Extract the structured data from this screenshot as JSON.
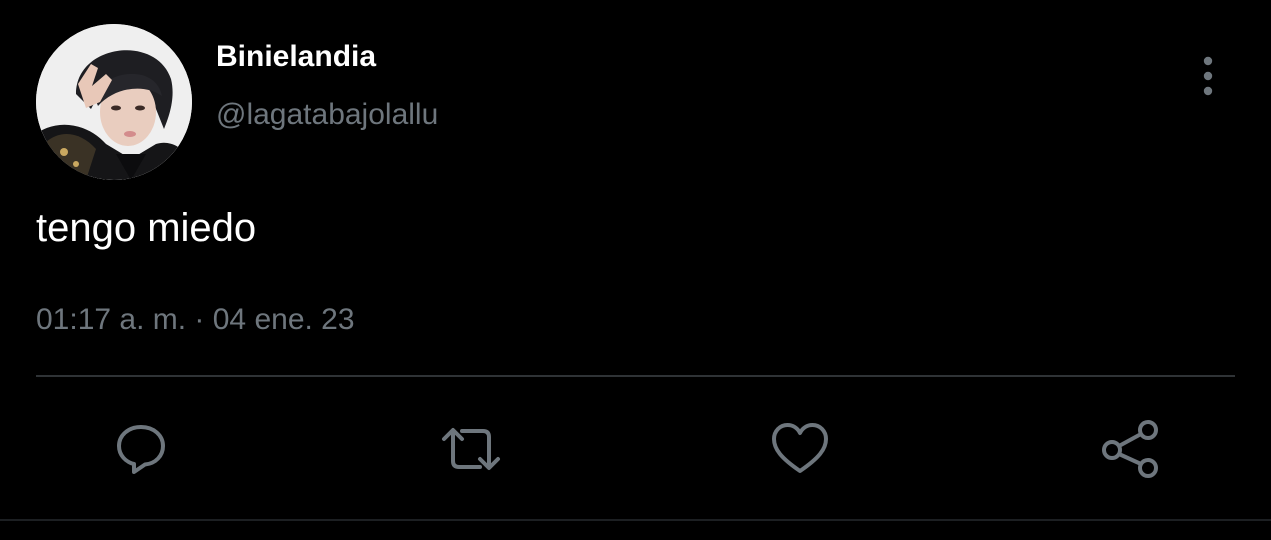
{
  "user": {
    "display_name": "Binielandia",
    "handle": "@lagatabajolallu",
    "avatar_icon": "profile-photo"
  },
  "tweet": {
    "text": "tengo miedo",
    "timestamp": "01:17 a. m. · 04 ene. 23"
  },
  "actions": {
    "more": "more-options-icon",
    "reply": "reply-icon",
    "retweet": "retweet-icon",
    "like": "heart-icon",
    "share": "share-icon"
  },
  "colors": {
    "background": "#000000",
    "primary_text": "#ffffff",
    "secondary_text": "#6e767d",
    "icon": "#6e767d",
    "divider": "#2f3336"
  }
}
